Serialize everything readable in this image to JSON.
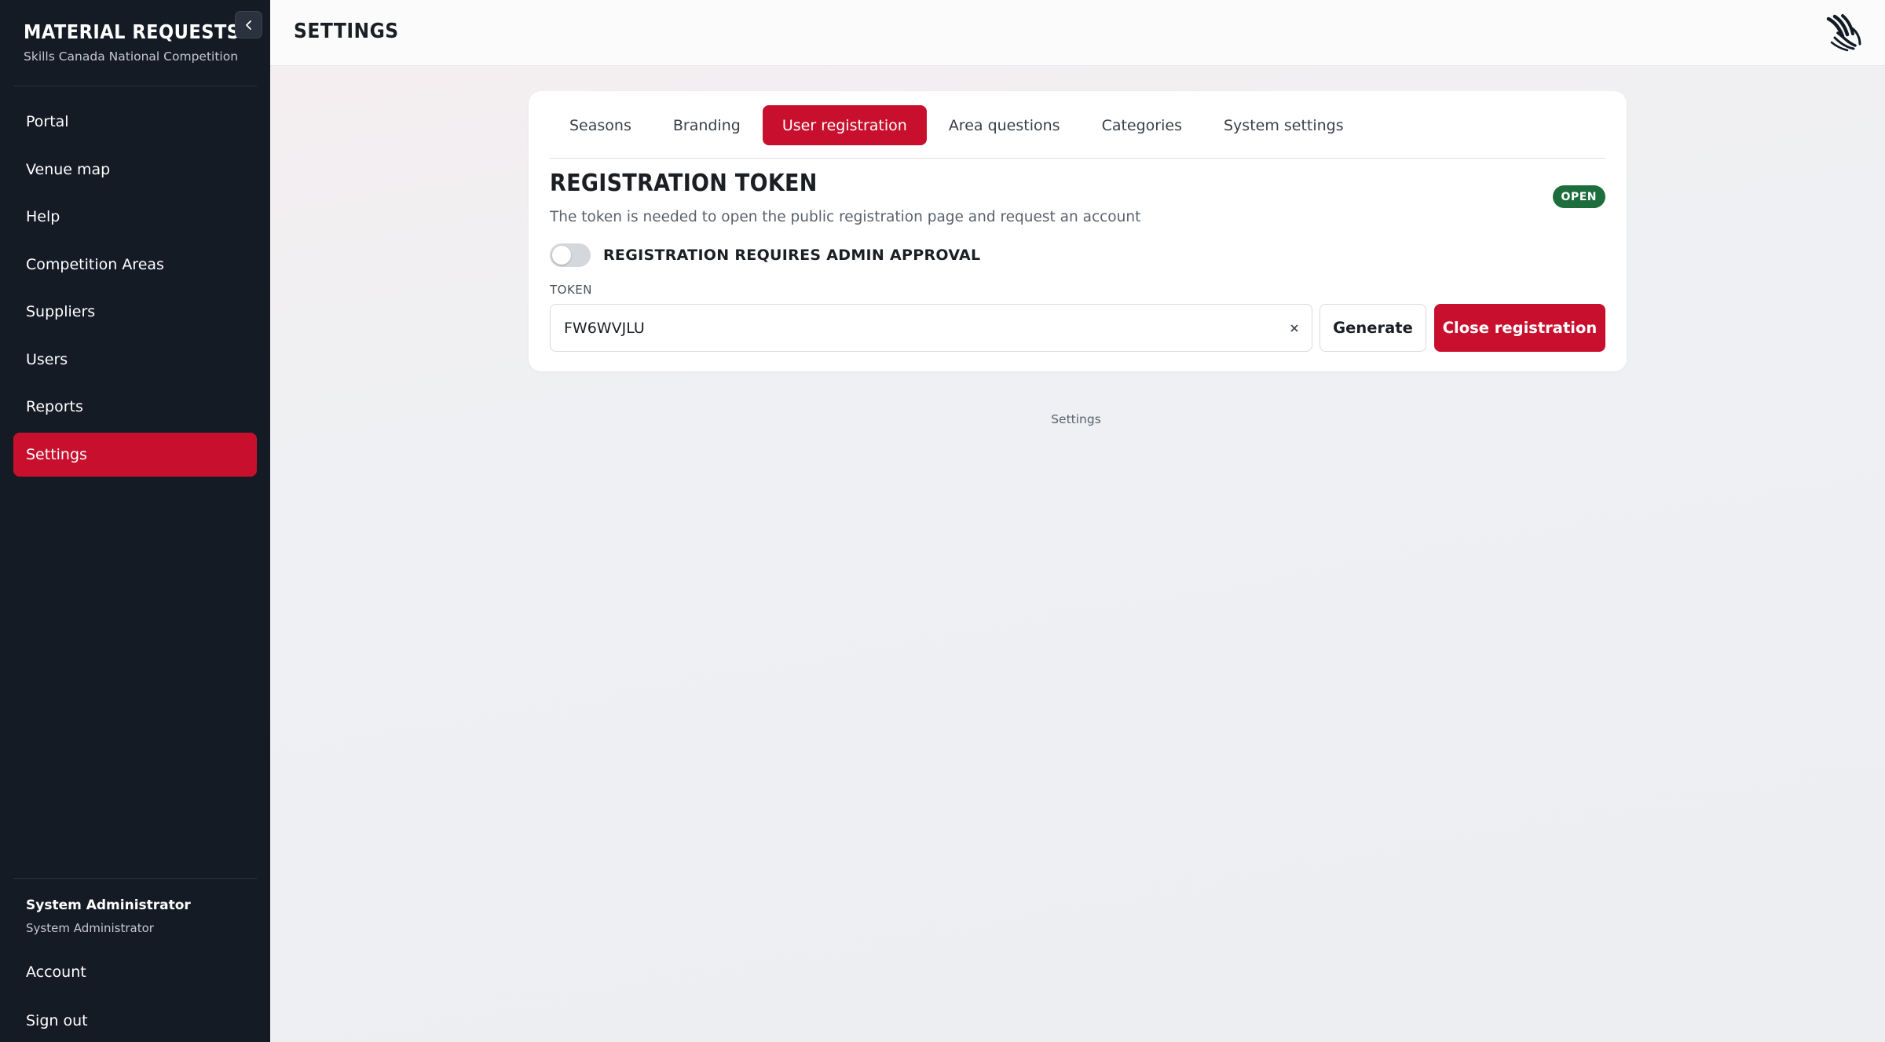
{
  "app": {
    "title": "MATERIAL REQUESTS",
    "subtitle": "Skills Canada National Competition"
  },
  "sidebar": {
    "collapse_icon": "chevron-left-icon",
    "items": [
      {
        "label": "Portal",
        "active": false
      },
      {
        "label": "Venue map",
        "active": false
      },
      {
        "label": "Help",
        "active": false
      },
      {
        "label": "Competition Areas",
        "active": false
      },
      {
        "label": "Suppliers",
        "active": false
      },
      {
        "label": "Users",
        "active": false
      },
      {
        "label": "Reports",
        "active": false
      },
      {
        "label": "Settings",
        "active": true
      }
    ],
    "user": {
      "name": "System Administrator",
      "role": "System Administrator"
    },
    "bottom_items": [
      {
        "label": "Account"
      },
      {
        "label": "Sign out"
      }
    ]
  },
  "header": {
    "title": "SETTINGS",
    "logo_icon": "brand-hands-logo-icon"
  },
  "settings": {
    "tabs": [
      {
        "label": "Seasons",
        "active": false
      },
      {
        "label": "Branding",
        "active": false
      },
      {
        "label": "User registration",
        "active": true
      },
      {
        "label": "Area questions",
        "active": false
      },
      {
        "label": "Categories",
        "active": false
      },
      {
        "label": "System settings",
        "active": false
      }
    ],
    "registration": {
      "title": "REGISTRATION TOKEN",
      "status": "OPEN",
      "description": "The token is needed to open the public registration page and request an account",
      "approval_toggle_label": "REGISTRATION REQUIRES ADMIN APPROVAL",
      "approval_enabled": false,
      "token_label": "TOKEN",
      "token_value": "FW6WVJLU",
      "generate_label": "Generate",
      "close_label": "Close registration"
    }
  },
  "footer": {
    "breadcrumb": "Settings"
  },
  "colors": {
    "accent": "#c8102e",
    "sidebar_bg": "#141b25",
    "status_open": "#1e6e3d"
  }
}
